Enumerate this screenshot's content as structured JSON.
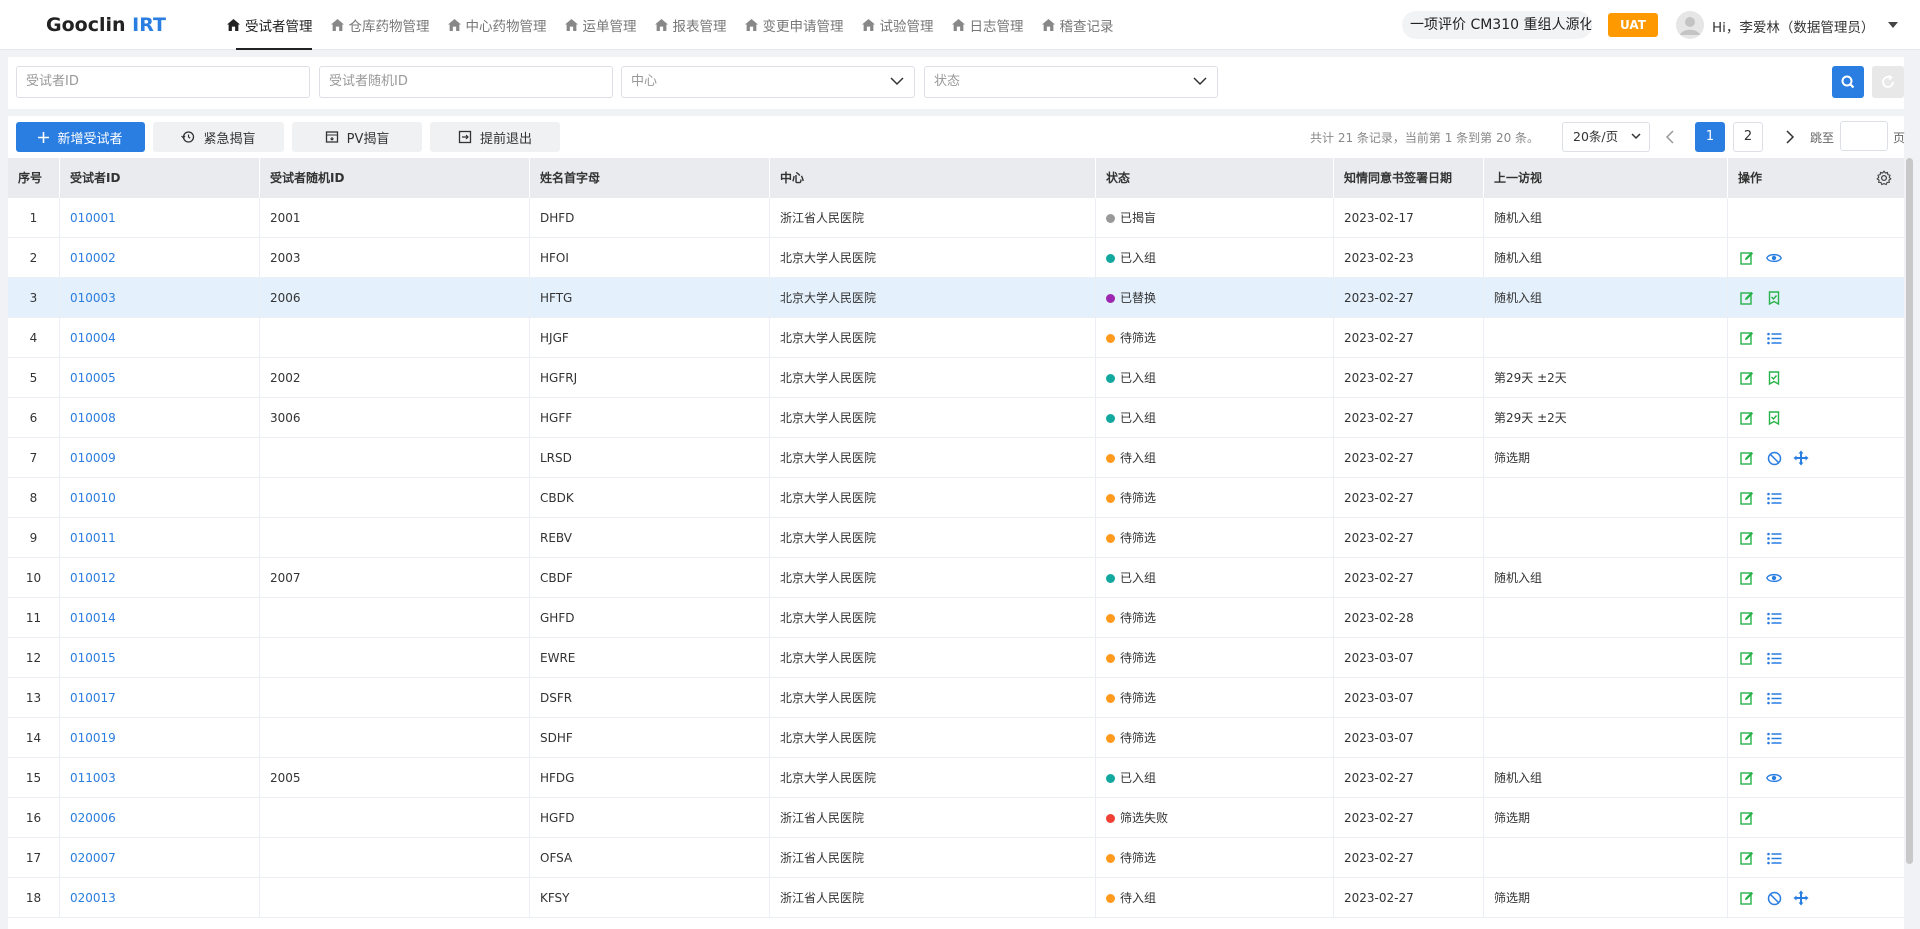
{
  "app": {
    "logo_main": "Gooclin",
    "logo_accent": "IRT"
  },
  "nav": [
    {
      "label": "受试者管理",
      "active": true
    },
    {
      "label": "仓库药物管理"
    },
    {
      "label": "中心药物管理"
    },
    {
      "label": "运单管理"
    },
    {
      "label": "报表管理"
    },
    {
      "label": "变更申请管理"
    },
    {
      "label": "试验管理"
    },
    {
      "label": "日志管理"
    },
    {
      "label": "稽查记录"
    }
  ],
  "header": {
    "trial": "一项评价 CM310 重组人源化",
    "env": "UAT",
    "user": "Hi，李爱林（数据管理员）"
  },
  "filters": {
    "subject_id": "受试者ID",
    "random_id": "受试者随机ID",
    "center": "中心",
    "status": "状态"
  },
  "toolbar": {
    "add": "新增受试者",
    "emergency": "紧急揭盲",
    "pv": "PV揭盲",
    "withdraw": "提前退出"
  },
  "pager": {
    "info": "共计 21 条记录，当前第 1 条到第  20  条。",
    "page_size": "20条/页",
    "pages": [
      "1",
      "2"
    ],
    "current": "1",
    "jump_label": "跳至",
    "jump_unit": "页"
  },
  "table": {
    "columns": [
      "序号",
      "受试者ID",
      "受试者随机ID",
      "姓名首字母",
      "中心",
      "状态",
      "知情同意书签署日期",
      "上一访视",
      "操作"
    ],
    "rows": [
      {
        "idx": "1",
        "id": "010001",
        "rand": "2001",
        "init": "DHFD",
        "center": "浙江省人民医院",
        "status": "已揭盲",
        "date": "2023-02-17",
        "visit": "随机入组"
      },
      {
        "idx": "2",
        "id": "010002",
        "rand": "2003",
        "init": "HFOI",
        "center": "北京大学人民医院",
        "status": "已入组",
        "date": "2023-02-23",
        "visit": "随机入组"
      },
      {
        "idx": "3",
        "id": "010003",
        "rand": "2006",
        "init": "HFTG",
        "center": "北京大学人民医院",
        "status": "已替换",
        "date": "2023-02-27",
        "visit": "随机入组"
      },
      {
        "idx": "4",
        "id": "010004",
        "rand": "",
        "init": "HJGF",
        "center": "北京大学人民医院",
        "status": "待筛选",
        "date": "2023-02-27",
        "visit": ""
      },
      {
        "idx": "5",
        "id": "010005",
        "rand": "2002",
        "init": "HGFRJ",
        "center": "北京大学人民医院",
        "status": "已入组",
        "date": "2023-02-27",
        "visit": "第29天 ±2天"
      },
      {
        "idx": "6",
        "id": "010008",
        "rand": "3006",
        "init": "HGFF",
        "center": "北京大学人民医院",
        "status": "已入组",
        "date": "2023-02-27",
        "visit": "第29天 ±2天"
      },
      {
        "idx": "7",
        "id": "010009",
        "rand": "",
        "init": "LRSD",
        "center": "北京大学人民医院",
        "status": "待入组",
        "date": "2023-02-27",
        "visit": "筛选期"
      },
      {
        "idx": "8",
        "id": "010010",
        "rand": "",
        "init": "CBDK",
        "center": "北京大学人民医院",
        "status": "待筛选",
        "date": "2023-02-27",
        "visit": ""
      },
      {
        "idx": "9",
        "id": "010011",
        "rand": "",
        "init": "REBV",
        "center": "北京大学人民医院",
        "status": "待筛选",
        "date": "2023-02-27",
        "visit": ""
      },
      {
        "idx": "10",
        "id": "010012",
        "rand": "2007",
        "init": "CBDF",
        "center": "北京大学人民医院",
        "status": "已入组",
        "date": "2023-02-27",
        "visit": "随机入组"
      },
      {
        "idx": "11",
        "id": "010014",
        "rand": "",
        "init": "GHFD",
        "center": "北京大学人民医院",
        "status": "待筛选",
        "date": "2023-02-28",
        "visit": ""
      },
      {
        "idx": "12",
        "id": "010015",
        "rand": "",
        "init": "EWRE",
        "center": "北京大学人民医院",
        "status": "待筛选",
        "date": "2023-03-07",
        "visit": ""
      },
      {
        "idx": "13",
        "id": "010017",
        "rand": "",
        "init": "DSFR",
        "center": "北京大学人民医院",
        "status": "待筛选",
        "date": "2023-03-07",
        "visit": ""
      },
      {
        "idx": "14",
        "id": "010019",
        "rand": "",
        "init": "SDHF",
        "center": "北京大学人民医院",
        "status": "待筛选",
        "date": "2023-03-07",
        "visit": ""
      },
      {
        "idx": "15",
        "id": "011003",
        "rand": "2005",
        "init": "HFDG",
        "center": "北京大学人民医院",
        "status": "已入组",
        "date": "2023-02-27",
        "visit": "随机入组"
      },
      {
        "idx": "16",
        "id": "020006",
        "rand": "",
        "init": "HGFD",
        "center": "浙江省人民医院",
        "status": "筛选失败",
        "date": "2023-02-27",
        "visit": "筛选期"
      },
      {
        "idx": "17",
        "id": "020007",
        "rand": "",
        "init": "OFSA",
        "center": "浙江省人民医院",
        "status": "待筛选",
        "date": "2023-02-27",
        "visit": ""
      },
      {
        "idx": "18",
        "id": "020013",
        "rand": "",
        "init": "KFSY",
        "center": "浙江省人民医院",
        "status": "待入组",
        "date": "2023-02-27",
        "visit": "筛选期"
      }
    ]
  },
  "status_colors": {
    "已揭盲": "#999999",
    "已入组": "#13a89e",
    "已替换": "#9c27b0",
    "待筛选": "#ff9a1f",
    "待入组": "#ff9a1f",
    "筛选失败": "#f04134"
  },
  "row_actions": {
    "1": [],
    "2": [
      "edit-icon",
      "view-icon"
    ],
    "3": [
      "edit-icon",
      "replace-icon"
    ],
    "4": [
      "edit-icon",
      "list-icon"
    ],
    "5": [
      "edit-icon",
      "replace-icon"
    ],
    "6": [
      "edit-icon",
      "replace-icon"
    ],
    "7": [
      "edit-icon",
      "ban-icon",
      "move-icon"
    ],
    "8": [
      "edit-icon",
      "list-icon"
    ],
    "9": [
      "edit-icon",
      "list-icon"
    ],
    "10": [
      "edit-icon",
      "view-icon"
    ],
    "11": [
      "edit-icon",
      "list-icon"
    ],
    "12": [
      "edit-icon",
      "list-icon"
    ],
    "13": [
      "edit-icon",
      "list-icon"
    ],
    "14": [
      "edit-icon",
      "list-icon"
    ],
    "15": [
      "edit-icon",
      "view-icon"
    ],
    "16": [
      "edit-icon"
    ],
    "17": [
      "edit-icon",
      "list-icon"
    ],
    "18": [
      "edit-icon",
      "ban-icon",
      "move-icon"
    ]
  },
  "highlight_row": "3"
}
